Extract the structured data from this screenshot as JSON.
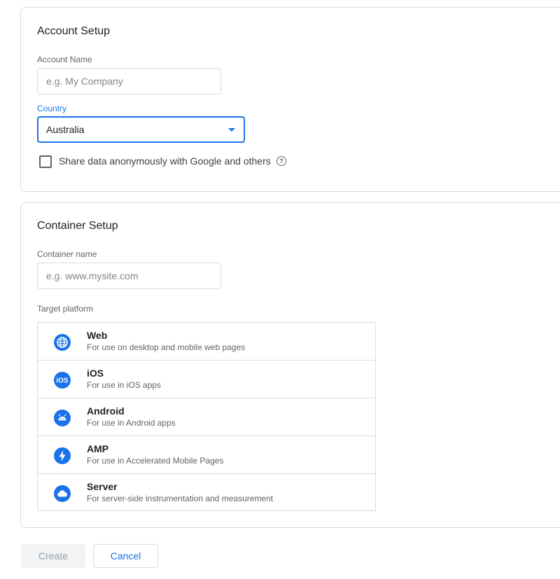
{
  "account_setup": {
    "title": "Account Setup",
    "account_name_label": "Account Name",
    "account_name_placeholder": "e.g. My Company",
    "account_name_value": "",
    "country_label": "Country",
    "country_value": "Australia",
    "share_data_label": "Share data anonymously with Google and others",
    "share_data_checked": false,
    "help_icon": "help-circle-icon"
  },
  "container_setup": {
    "title": "Container Setup",
    "container_name_label": "Container name",
    "container_name_placeholder": "e.g. www.mysite.com",
    "container_name_value": "",
    "target_platform_label": "Target platform",
    "platforms": [
      {
        "name": "Web",
        "description": "For use on desktop and mobile web pages",
        "icon": "globe-icon"
      },
      {
        "name": "iOS",
        "description": "For use in iOS apps",
        "icon": "ios-icon"
      },
      {
        "name": "Android",
        "description": "For use in Android apps",
        "icon": "android-icon"
      },
      {
        "name": "AMP",
        "description": "For use in Accelerated Mobile Pages",
        "icon": "lightning-bolt-icon"
      },
      {
        "name": "Server",
        "description": "For server-side instrumentation and measurement",
        "icon": "cloud-icon"
      }
    ]
  },
  "actions": {
    "create_label": "Create",
    "cancel_label": "Cancel"
  },
  "colors": {
    "accent": "#1a73e8",
    "border": "#dadce0",
    "disabled_bg": "#f1f3f4",
    "disabled_text": "#9aa0a6"
  }
}
